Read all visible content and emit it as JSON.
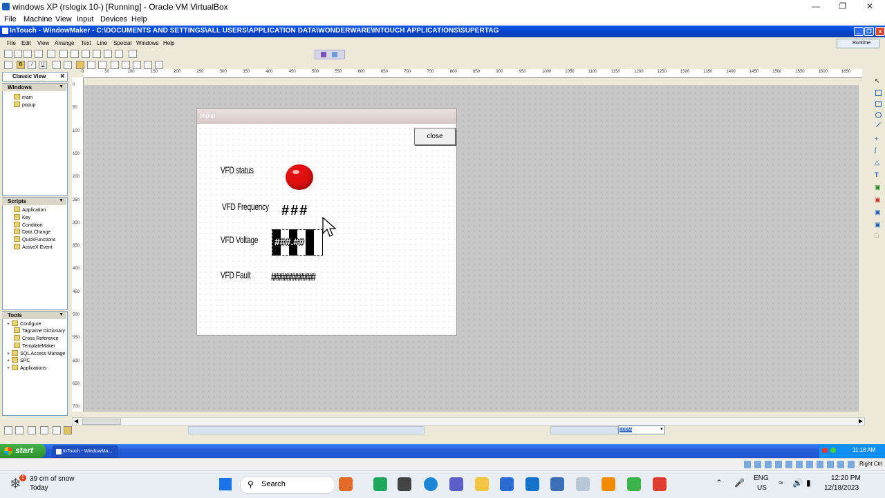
{
  "vbox": {
    "title": "windows XP (rslogix 10-) [Running] - Oracle VM VirtualBox",
    "menu": [
      "File",
      "Machine",
      "View",
      "Input",
      "Devices",
      "Help"
    ]
  },
  "intouch": {
    "title": "InTouch - WindowMaker - C:\\DOCUMENTS AND SETTINGS\\ALL USERS\\APPLICATION DATA\\WONDERWARE\\INTOUCH APPLICATIONS\\SUPERTAG",
    "menu": [
      "File",
      "Edit",
      "View",
      "Arrange",
      "Text",
      "Line",
      "Special",
      "Windows",
      "Help"
    ],
    "runtime_label": "Runtime"
  },
  "left_panel": {
    "classic_view": "Classic View",
    "windows_header": "Windows",
    "windows": [
      "main",
      "popup"
    ],
    "scripts_header": "Scripts",
    "scripts": [
      "Application",
      "Key",
      "Condition",
      "Data Change",
      "QuickFunctions",
      "ActiveX Event"
    ],
    "tools_header": "Tools",
    "tools": [
      "Configure",
      "Tagname Dictionary",
      "Cross Reference",
      "TemplateMaker",
      "SQL Access Manage",
      "SPC",
      "Applications"
    ]
  },
  "ruler": {
    "h": [
      "0",
      "50",
      "100",
      "150",
      "200",
      "250",
      "300",
      "350",
      "400",
      "450",
      "500",
      "550",
      "600",
      "650",
      "700",
      "750",
      "800",
      "850",
      "900",
      "950",
      "1000",
      "1050",
      "1100",
      "1150",
      "1200",
      "1250",
      "1300",
      "1350",
      "1400",
      "1450",
      "1500",
      "1550",
      "1600",
      "1650"
    ],
    "v": [
      "0",
      "50",
      "100",
      "150",
      "200",
      "250",
      "300",
      "350",
      "400",
      "450",
      "500",
      "550",
      "600",
      "650",
      "700"
    ]
  },
  "popup": {
    "title": "popup",
    "close_label": "close",
    "rows": [
      {
        "label": "VFD status",
        "value": ""
      },
      {
        "label": "VFD Frequency",
        "value": "###"
      },
      {
        "label": "VFD Voltage",
        "value": "###.##"
      },
      {
        "label": "VFD Fault",
        "value": "##############"
      }
    ],
    "status_color": "#e01010"
  },
  "status_bar": {
    "zoom": "100%"
  },
  "xp_taskbar": {
    "start_label": "start",
    "task_label": "InTouch - WindowMa...",
    "clock": "11:18 AM"
  },
  "vbox_status": {
    "host_key": "Right Ctrl"
  },
  "win_taskbar": {
    "weather_badge": "1",
    "weather_text": "39 cm of snow",
    "weather_sub": "Today",
    "search_label": "Search",
    "lang": "ENG",
    "region": "US",
    "time": "12:20 PM",
    "date": "12/18/2023"
  }
}
